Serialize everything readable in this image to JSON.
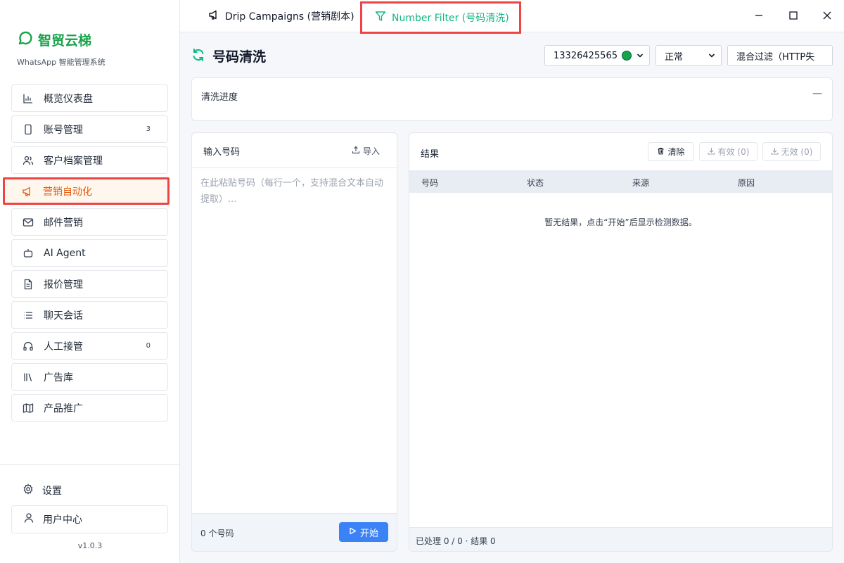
{
  "brand": {
    "name": "智贸云梯",
    "subtitle": "WhatsApp 智能管理系统",
    "color": "#16a34a"
  },
  "sidebar": {
    "items": [
      {
        "label": "概览仪表盘",
        "icon": "bar-chart-icon",
        "badge": ""
      },
      {
        "label": "账号管理",
        "icon": "phone-icon",
        "badge": "3"
      },
      {
        "label": "客户档案管理",
        "icon": "users-icon",
        "badge": ""
      },
      {
        "label": "营销自动化",
        "icon": "megaphone-icon",
        "badge": "",
        "active": true
      },
      {
        "label": "邮件营销",
        "icon": "mail-icon",
        "badge": ""
      },
      {
        "label": "AI Agent",
        "icon": "bot-icon",
        "badge": ""
      },
      {
        "label": "报价管理",
        "icon": "file-text-icon",
        "badge": ""
      },
      {
        "label": "聊天会话",
        "icon": "list-icon",
        "badge": ""
      },
      {
        "label": "人工接管",
        "icon": "headset-icon",
        "badge": "0"
      },
      {
        "label": "广告库",
        "icon": "library-icon",
        "badge": ""
      },
      {
        "label": "产品推广",
        "icon": "map-icon",
        "badge": ""
      }
    ],
    "settings_label": "设置",
    "user_center_label": "用户中心",
    "version": "v1.0.3"
  },
  "tabs": [
    {
      "label": "Drip Campaigns (营销剧本)",
      "icon": "megaphone-icon"
    },
    {
      "label": "Number Filter (号码清洗)",
      "icon": "filter-icon",
      "active": true
    }
  ],
  "header": {
    "title": "号码清洗",
    "account_select": "13326425565",
    "mode_select": "正常",
    "filter_select": "混合过滤（HTTP失"
  },
  "progress": {
    "title": "清洗进度",
    "toggle": "—"
  },
  "input_panel": {
    "title": "输入号码",
    "import_label": "导入",
    "placeholder": "在此粘贴号码（每行一个，支持混合文本自动提取）...",
    "count_text": "0 个号码",
    "start_label": "开始"
  },
  "result_panel": {
    "title": "结果",
    "clear_label": "清除",
    "valid_label": "有效 (0)",
    "invalid_label": "无效 (0)",
    "columns": [
      "号码",
      "状态",
      "来源",
      "原因"
    ],
    "empty_text": "暂无结果，点击“开始”后显示检测数据。",
    "footer_text": "已处理 0 / 0 · 结果 0"
  },
  "colors": {
    "accent": "#10b981",
    "primary": "#3b82f6",
    "active_text": "#ea580c",
    "highlight_border": "#ef4444"
  }
}
